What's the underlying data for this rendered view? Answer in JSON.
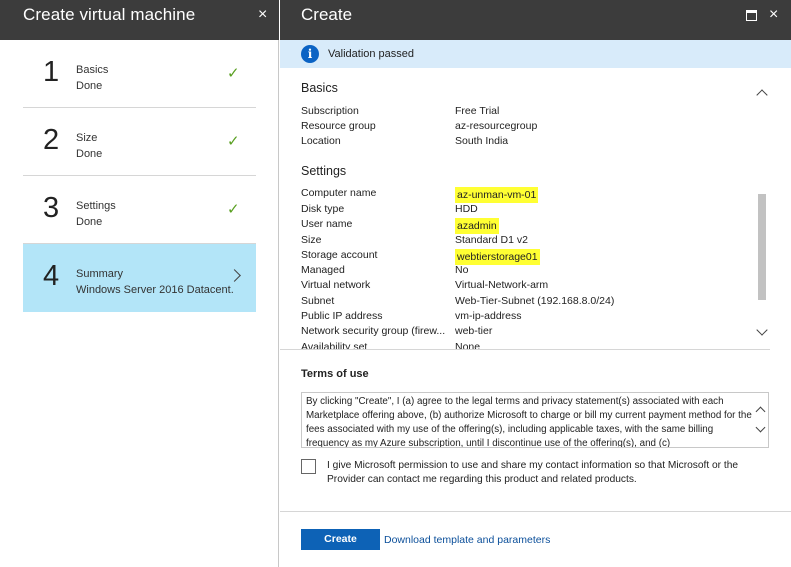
{
  "left_blade": {
    "title": "Create virtual machine",
    "close_icon": "×",
    "steps": [
      {
        "number": "1",
        "name": "Basics",
        "status": "Done",
        "icon": "check-icon"
      },
      {
        "number": "2",
        "name": "Size",
        "status": "Done",
        "icon": "check-icon"
      },
      {
        "number": "3",
        "name": "Settings",
        "status": "Done",
        "icon": "check-icon"
      },
      {
        "number": "4",
        "name": "Summary",
        "status": "Windows Server 2016 Datacent...",
        "icon": "chevron-right-icon",
        "active": true
      }
    ],
    "check_glyph": "✓"
  },
  "right_blade": {
    "title": "Create",
    "close_icon": "×",
    "banner": {
      "icon": "info-icon",
      "icon_glyph": "i",
      "message": "Validation passed"
    },
    "basics": {
      "title": "Basics",
      "rows": [
        {
          "key": "Subscription",
          "value": "Free Trial"
        },
        {
          "key": "Resource group",
          "value": "az-resourcegroup"
        },
        {
          "key": "Location",
          "value": "South India"
        }
      ]
    },
    "settings": {
      "title": "Settings",
      "rows": [
        {
          "key": "Computer name",
          "value": "az-unman-vm-01",
          "highlight": true
        },
        {
          "key": "Disk type",
          "value": "HDD"
        },
        {
          "key": "User name",
          "value": "azadmin",
          "highlight": true
        },
        {
          "key": "Size",
          "value": "Standard D1 v2"
        },
        {
          "key": "Storage account",
          "value": "webtierstorage01",
          "highlight": true
        },
        {
          "key": "Managed",
          "value": "No"
        },
        {
          "key": "Virtual network",
          "value": "Virtual-Network-arm"
        },
        {
          "key": "Subnet",
          "value": "Web-Tier-Subnet (192.168.8.0/24)"
        },
        {
          "key": "Public IP address",
          "value": "vm-ip-address"
        },
        {
          "key": "Network security group (firew...",
          "value": "web-tier"
        },
        {
          "key": "Availability set",
          "value": "None"
        }
      ]
    },
    "terms": {
      "title": "Terms of use",
      "text": "By clicking \"Create\", I (a) agree to the legal terms and privacy statement(s) associated with each Marketplace offering above, (b) authorize Microsoft to charge or bill my current payment method for the fees associated with my use of the offering(s), including applicable taxes, with the same billing frequency as my Azure subscription, until I discontinue use of the offering(s), and (c)"
    },
    "consent": {
      "checked": false,
      "text": "I give Microsoft permission to use and share my contact information so that Microsoft or the Provider can contact me regarding this product and related products."
    },
    "footer": {
      "create_label": "Create",
      "download_label": "Download template and parameters"
    }
  },
  "colors": {
    "header_bg": "#3c3c3c",
    "active_step_bg": "#b3e5f8",
    "banner_bg": "#d8ebfa",
    "check_color": "#5aa022",
    "primary_button": "#0d62b6",
    "highlight": "#ffff33"
  }
}
